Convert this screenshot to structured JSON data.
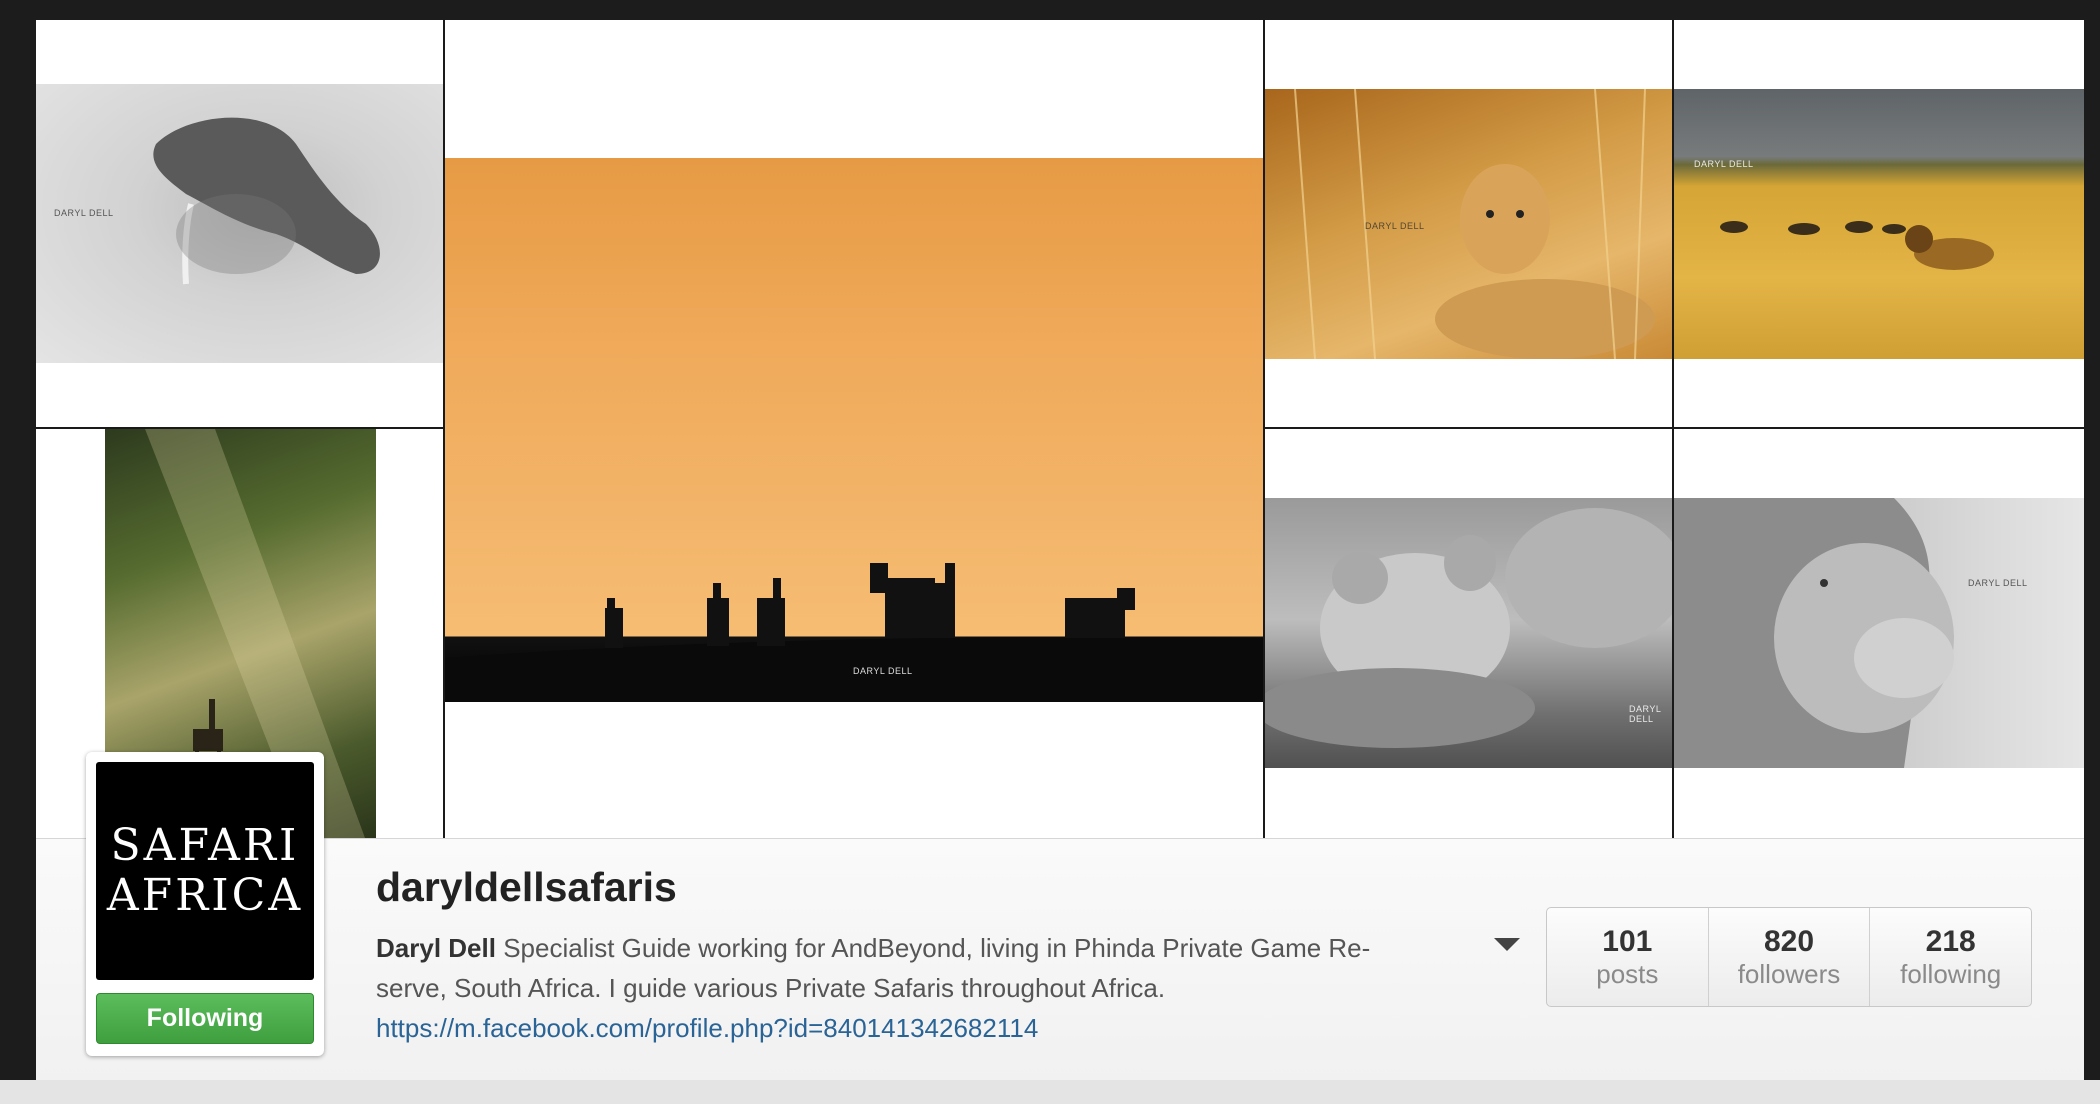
{
  "grid": {
    "watermark": "DARYL DELL"
  },
  "profile": {
    "avatar_line1": "SAFARI",
    "avatar_line2": "AFRICA",
    "follow_label": "Following",
    "username": "daryldellsafaris",
    "full_name": "Daryl Dell",
    "bio": "Specialist Guide working for AndBeyond, living in Phinda Private Game Re-serve, South Africa. I guide various Private Safaris throughout Africa.",
    "link": "https://m.facebook.com/profile.php?id=840141342682114",
    "stats": [
      {
        "value": "101",
        "label": "posts"
      },
      {
        "value": "820",
        "label": "followers"
      },
      {
        "value": "218",
        "label": "following"
      }
    ]
  },
  "colors": {
    "follow_green": "#4cae4c",
    "link_blue": "#2a6496"
  },
  "icons": {
    "menu_caret": "chevron-down-icon"
  }
}
